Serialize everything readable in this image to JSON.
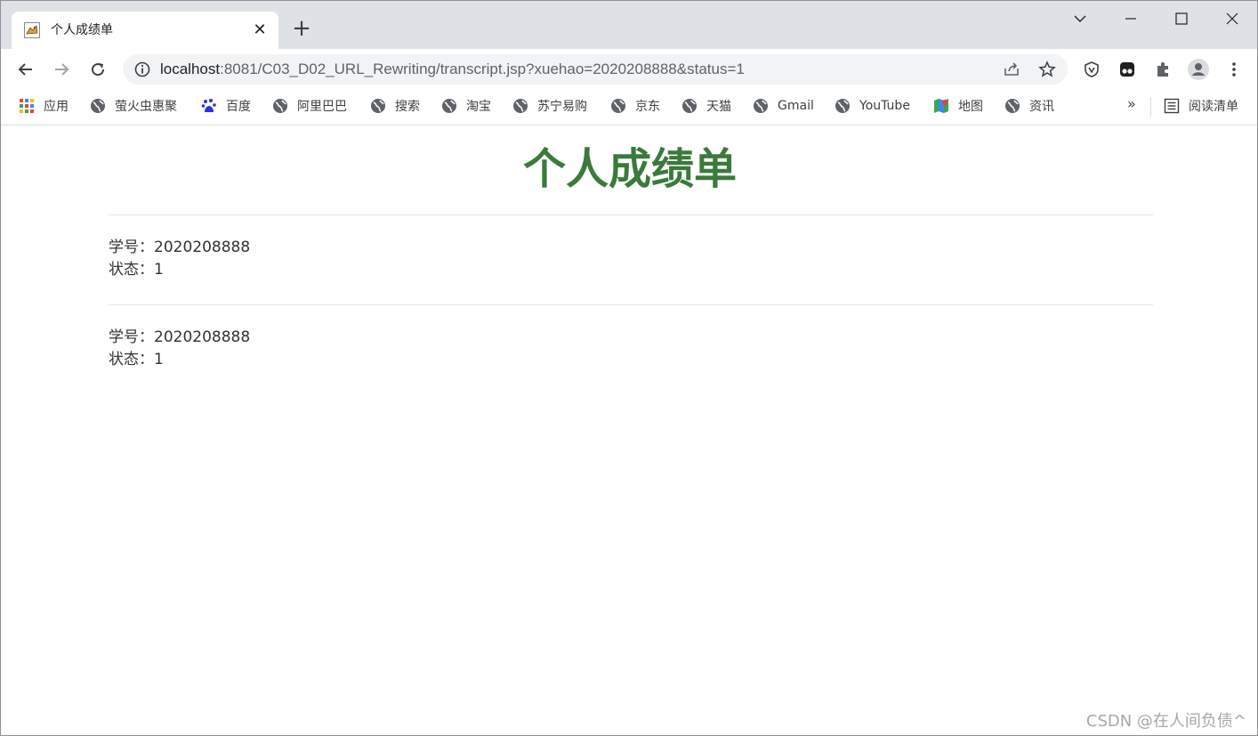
{
  "tab": {
    "title": "个人成绩单",
    "close_glyph": "✕",
    "new_tab_glyph": "+"
  },
  "address": {
    "host": "localhost",
    "rest": ":8081/C03_D02_URL_Rewriting/transcript.jsp?xuehao=2020208888&status=1"
  },
  "bookmarks": [
    {
      "label": "应用",
      "icon": "apps-grid-icon"
    },
    {
      "label": "萤火虫惠聚",
      "icon": "globe-icon"
    },
    {
      "label": "百度",
      "icon": "baidu-paw-icon"
    },
    {
      "label": "阿里巴巴",
      "icon": "globe-icon"
    },
    {
      "label": "搜索",
      "icon": "globe-icon"
    },
    {
      "label": "淘宝",
      "icon": "globe-icon"
    },
    {
      "label": "苏宁易购",
      "icon": "globe-icon"
    },
    {
      "label": "京东",
      "icon": "globe-icon"
    },
    {
      "label": "天猫",
      "icon": "globe-icon"
    },
    {
      "label": "Gmail",
      "icon": "globe-icon"
    },
    {
      "label": "YouTube",
      "icon": "globe-icon"
    },
    {
      "label": "地图",
      "icon": "maps-icon"
    },
    {
      "label": "资讯",
      "icon": "globe-icon"
    }
  ],
  "bookmarks_overflow": "»",
  "reading_list": {
    "label": "阅读清单",
    "icon": "reading-list-icon"
  },
  "page": {
    "heading": "个人成绩单",
    "records": [
      {
        "xuehao_line": "学号：2020208888",
        "status_line": "状态：1"
      },
      {
        "xuehao_line": "学号：2020208888",
        "status_line": "状态：1"
      }
    ]
  },
  "watermark": "CSDN @在人间负债^",
  "colors": {
    "heading": "#3a7a3a",
    "tabstrip": "#dee1e6",
    "omnibox": "#f1f3f4"
  }
}
